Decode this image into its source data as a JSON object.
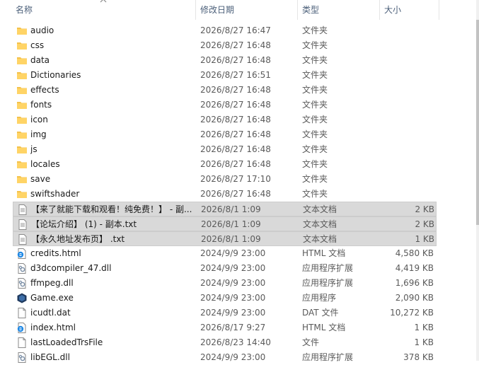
{
  "columns": {
    "name": "名称",
    "date": "修改日期",
    "type": "类型",
    "size": "大小"
  },
  "files": [
    {
      "name": "audio",
      "date": "2026/8/27 16:47",
      "type": "文件夹",
      "size": "",
      "icon": "folder-icon",
      "selected": false
    },
    {
      "name": "css",
      "date": "2026/8/27 16:48",
      "type": "文件夹",
      "size": "",
      "icon": "folder-icon",
      "selected": false
    },
    {
      "name": "data",
      "date": "2026/8/27 16:48",
      "type": "文件夹",
      "size": "",
      "icon": "folder-icon",
      "selected": false
    },
    {
      "name": "Dictionaries",
      "date": "2026/8/27 16:51",
      "type": "文件夹",
      "size": "",
      "icon": "folder-icon",
      "selected": false
    },
    {
      "name": "effects",
      "date": "2026/8/27 16:48",
      "type": "文件夹",
      "size": "",
      "icon": "folder-icon",
      "selected": false
    },
    {
      "name": "fonts",
      "date": "2026/8/27 16:48",
      "type": "文件夹",
      "size": "",
      "icon": "folder-icon",
      "selected": false
    },
    {
      "name": "icon",
      "date": "2026/8/27 16:48",
      "type": "文件夹",
      "size": "",
      "icon": "folder-icon",
      "selected": false
    },
    {
      "name": "img",
      "date": "2026/8/27 16:48",
      "type": "文件夹",
      "size": "",
      "icon": "folder-icon",
      "selected": false
    },
    {
      "name": "js",
      "date": "2026/8/27 16:48",
      "type": "文件夹",
      "size": "",
      "icon": "folder-icon",
      "selected": false
    },
    {
      "name": "locales",
      "date": "2026/8/27 16:48",
      "type": "文件夹",
      "size": "",
      "icon": "folder-icon",
      "selected": false
    },
    {
      "name": "save",
      "date": "2026/8/27 17:10",
      "type": "文件夹",
      "size": "",
      "icon": "folder-icon",
      "selected": false
    },
    {
      "name": "swiftshader",
      "date": "2026/8/27 16:48",
      "type": "文件夹",
      "size": "",
      "icon": "folder-icon",
      "selected": false
    },
    {
      "name": "【来了就能下载和观看！纯免费！】 - 副...",
      "date": "2026/8/1 1:09",
      "type": "文本文档",
      "size": "2 KB",
      "icon": "text-file-icon",
      "selected": true
    },
    {
      "name": "【论坛介绍】 (1) - 副本.txt",
      "date": "2026/8/1 1:09",
      "type": "文本文档",
      "size": "2 KB",
      "icon": "text-file-icon",
      "selected": true
    },
    {
      "name": "【永久地址发布页】 .txt",
      "date": "2026/8/1 1:09",
      "type": "文本文档",
      "size": "1 KB",
      "icon": "text-file-icon",
      "selected": true
    },
    {
      "name": "credits.html",
      "date": "2024/9/9 23:00",
      "type": "HTML 文档",
      "size": "4,580 KB",
      "icon": "html-file-icon",
      "selected": false
    },
    {
      "name": "d3dcompiler_47.dll",
      "date": "2024/9/9 23:00",
      "type": "应用程序扩展",
      "size": "4,419 KB",
      "icon": "dll-file-icon",
      "selected": false
    },
    {
      "name": "ffmpeg.dll",
      "date": "2024/9/9 23:00",
      "type": "应用程序扩展",
      "size": "1,696 KB",
      "icon": "dll-file-icon",
      "selected": false
    },
    {
      "name": "Game.exe",
      "date": "2024/9/9 23:00",
      "type": "应用程序",
      "size": "2,090 KB",
      "icon": "exe-icon",
      "selected": false
    },
    {
      "name": "icudtl.dat",
      "date": "2024/9/9 23:00",
      "type": "DAT 文件",
      "size": "10,272 KB",
      "icon": "blank-file-icon",
      "selected": false
    },
    {
      "name": "index.html",
      "date": "2026/8/17 9:27",
      "type": "HTML 文档",
      "size": "1 KB",
      "icon": "html-file-icon",
      "selected": false
    },
    {
      "name": "lastLoadedTrsFile",
      "date": "2026/8/23 14:40",
      "type": "文件",
      "size": "1 KB",
      "icon": "blank-file-icon",
      "selected": false
    },
    {
      "name": "libEGL.dll",
      "date": "2024/9/9 23:00",
      "type": "应用程序扩展",
      "size": "378 KB",
      "icon": "dll-file-icon",
      "selected": false
    }
  ]
}
